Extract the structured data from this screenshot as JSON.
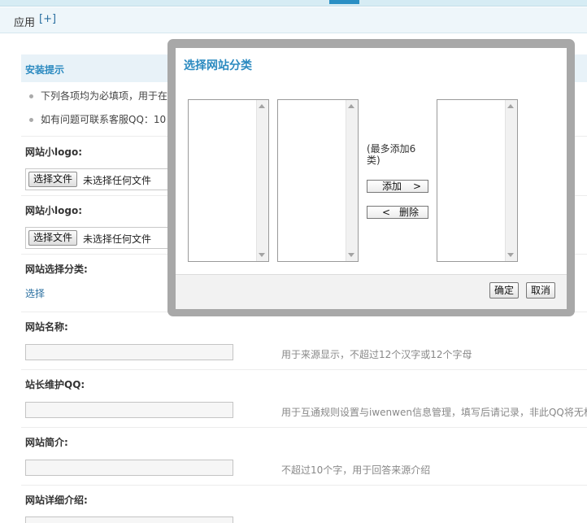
{
  "topbar": {},
  "appbar": {
    "label": "应用",
    "add": "[+]"
  },
  "tips": {
    "title": "安装提示",
    "items": [
      "下列各项均为必填项，用于在",
      "如有问题可联系客服QQ：10"
    ]
  },
  "form": {
    "logo1_label": "网站小logo:",
    "logo2_label": "网站小logo:",
    "file_button": "选择文件",
    "file_none": "未选择任何文件",
    "category_label": "网站选择分类:",
    "category_link": "选择",
    "name_label": "网站名称:",
    "name_hint": "用于来源显示，不超过12个汉字或12个字母",
    "qq_label": "站长维护QQ:",
    "qq_hint": "用于互通规则设置与iwenwen信息管理，填写后请记录，非此QQ将无权",
    "intro_label": "网站简介:",
    "intro_hint": "不超过10个字，用于回答来源介绍",
    "detail_label": "网站详细介绍:"
  },
  "modal": {
    "title": "选择网站分类",
    "max_note": "(最多添加6类)",
    "add_label": "添加",
    "add_arrow": ">",
    "remove_arrow": "<",
    "remove_label": "删除",
    "ok": "确定",
    "cancel": "取消"
  },
  "colors": {
    "accent": "#2b8ac0",
    "link": "#2a6fa0",
    "frame": "#a8a8a8"
  }
}
